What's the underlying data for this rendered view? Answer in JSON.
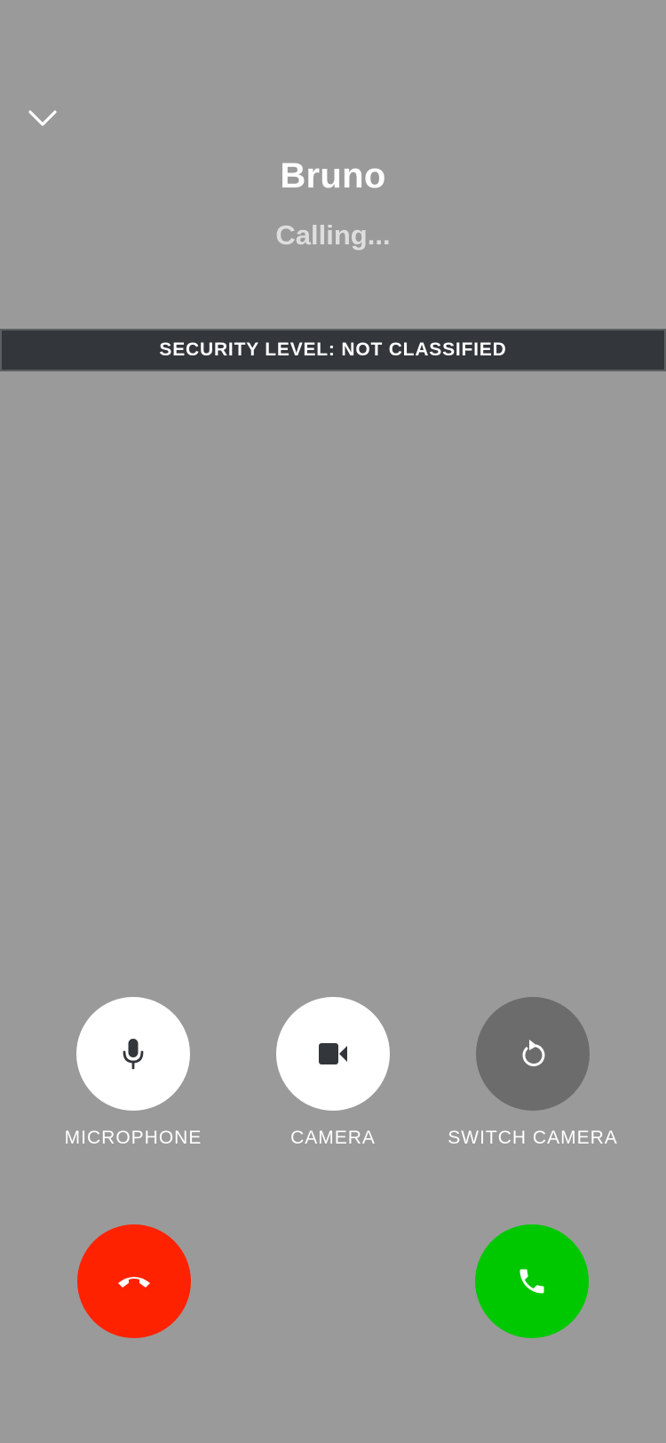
{
  "header": {
    "collapse_icon": "chevron-down-icon",
    "caller_name": "Bruno",
    "status": "Calling..."
  },
  "security_banner": {
    "text": "SECURITY LEVEL: NOT CLASSIFIED"
  },
  "controls": [
    {
      "label": "MICROPHONE",
      "icon": "microphone-icon",
      "state": "on"
    },
    {
      "label": "CAMERA",
      "icon": "video-camera-icon",
      "state": "on"
    },
    {
      "label": "SWITCH CAMERA",
      "icon": "switch-camera-icon",
      "state": "disabled"
    }
  ],
  "call_actions": {
    "decline_icon": "hang-up-icon",
    "accept_icon": "phone-icon"
  },
  "colors": {
    "background": "#9a9a9a",
    "security_bar": "#33373b",
    "control_active": "#ffffff",
    "control_disabled": "#6c6c6c",
    "decline": "#ff2200",
    "accept": "#00c800"
  }
}
